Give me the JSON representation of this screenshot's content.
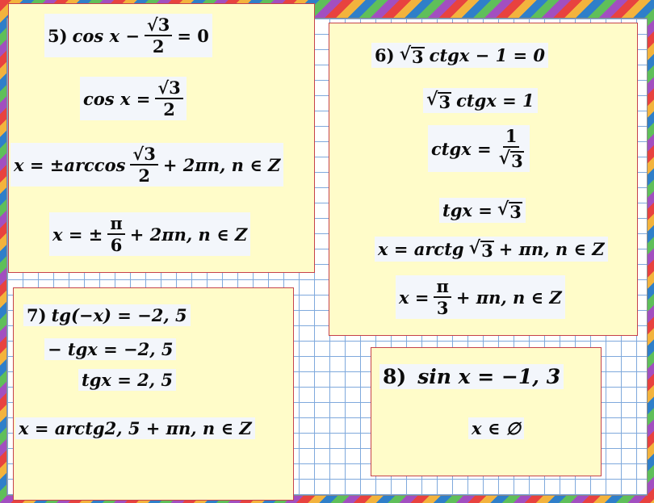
{
  "colors": {
    "card_bg": "#fffcc9",
    "card_border": "#c6424a",
    "grid_line": "#7fa9dc"
  },
  "task5": {
    "number": "5)",
    "l1": {
      "lhs": "cos x −",
      "num": "√3",
      "den": "2",
      "rhs": "= 0"
    },
    "l2": {
      "lhs": "cos x =",
      "num": "√3",
      "den": "2"
    },
    "l3": {
      "lhs": "x = ±arccos",
      "num": "√3",
      "den": "2",
      "rhs": "+ 2πn, n ∈ Z"
    },
    "l4": {
      "lhs": "x = ±",
      "num": "π",
      "den": "6",
      "rhs": "+ 2πn, n ∈ Z"
    }
  },
  "task6": {
    "number": "6)",
    "l1_rad": "3",
    "l1_rest": "ctgx − 1 = 0",
    "l2_rad": "3",
    "l2_rest": "ctgx = 1",
    "l3": {
      "lhs": "ctgx =",
      "num": "1",
      "den_rad": "3"
    },
    "l4_lhs": "tgx =",
    "l4_rad": "3",
    "l5_lhs": "x = arctg",
    "l5_rad": "3",
    "l5_rest": "+ πn, n ∈ Z",
    "l6": {
      "lhs": "x =",
      "num": "π",
      "den": "3",
      "rhs": "+ πn, n ∈ Z"
    }
  },
  "task7": {
    "number": "7)",
    "l1": "tg(−x) = −2, 5",
    "l2": "− tgx = −2, 5",
    "l3": "tgx = 2, 5",
    "l4": "x = arctg2, 5 + πn, n ∈ Z"
  },
  "task8": {
    "number": "8)",
    "l1": "sin x = −1, 3",
    "l2": "x ∈ ∅"
  }
}
